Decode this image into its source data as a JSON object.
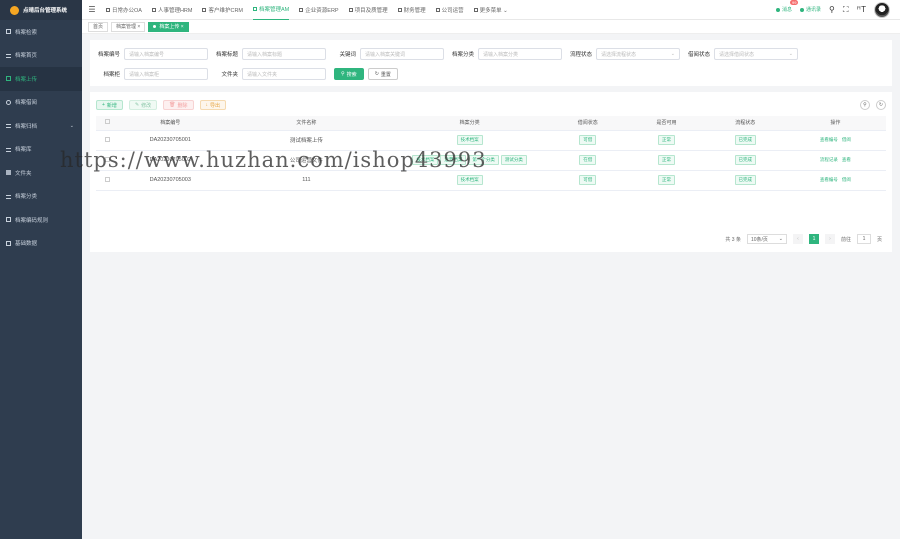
{
  "app": {
    "title": "点晴后台管理系统"
  },
  "sidebar": {
    "items": [
      {
        "label": "档案检索",
        "icon": "square-icon"
      },
      {
        "label": "档案首页",
        "icon": "bars-icon"
      },
      {
        "label": "档案上传",
        "icon": "square-icon",
        "active": true
      },
      {
        "label": "档案借阅",
        "icon": "gear-icon"
      },
      {
        "label": "档案归档",
        "icon": "bars-icon",
        "caret": "⌄"
      },
      {
        "label": "档案库",
        "icon": "bars-icon"
      },
      {
        "label": "文件夹",
        "icon": "chat-icon"
      },
      {
        "label": "档案分类",
        "icon": "bars-icon"
      },
      {
        "label": "档案编码规则",
        "icon": "square-icon"
      },
      {
        "label": "基础数据",
        "icon": "square-icon"
      }
    ]
  },
  "header": {
    "nav": [
      {
        "label": "日常办公OA"
      },
      {
        "label": "人事管理HRM"
      },
      {
        "label": "客户维护CRM"
      },
      {
        "label": "档案管理AM",
        "active": true
      },
      {
        "label": "企业资源ERP"
      },
      {
        "label": "项目及质管理"
      },
      {
        "label": "财务管理"
      },
      {
        "label": "公司运营"
      },
      {
        "label": "更多菜单 ⌄"
      }
    ],
    "notice_label": "消息",
    "notice_badge": "99",
    "contacts_label": "通讯录"
  },
  "tabs": [
    {
      "label": "首页"
    },
    {
      "label": "档案管理 ×"
    },
    {
      "label": "档案上传 ×",
      "active": true
    }
  ],
  "filters": {
    "row1": [
      {
        "label": "档案编号",
        "placeholder": "请输入档案编号"
      },
      {
        "label": "档案标题",
        "placeholder": "请输入档案标题"
      },
      {
        "label": "关键词",
        "placeholder": "请输入档案关键词"
      },
      {
        "label": "档案分类",
        "placeholder": "请输入档案分类"
      },
      {
        "label": "流程状态",
        "placeholder": "请选择流程状态",
        "select": true
      },
      {
        "label": "借阅状态",
        "placeholder": "请选择借阅状态",
        "select": true
      }
    ],
    "row2": [
      {
        "label": "档案柜",
        "placeholder": "请输入档案柜"
      },
      {
        "label": "文件夹",
        "placeholder": "请输入文件夹"
      }
    ],
    "search_label": "搜索",
    "reset_label": "重置"
  },
  "toolbar": {
    "add_label": "新增",
    "edit_label": "修改",
    "delete_label": "删除",
    "export_label": "导出"
  },
  "table": {
    "columns": [
      "档案编号",
      "文件名称",
      "档案分类",
      "借阅状态",
      "是否可用",
      "流程状态",
      "操作"
    ],
    "rows": [
      {
        "code": "DA20230705001",
        "name": "测试档案上传",
        "tags": [
          "技术档案"
        ],
        "borrow": "可借",
        "usable": "正常",
        "flow": "已完成",
        "ops": [
          "查看编号",
          "借阅"
        ]
      },
      {
        "code": "DA20230705002",
        "name": "公司运营文件",
        "tags": [
          "技术档案",
          "运营档案",
          "第一个分类",
          "测试分类"
        ],
        "borrow": "在借",
        "usable": "正常",
        "flow": "已完成",
        "ops": [
          "流程记录",
          "查看"
        ]
      },
      {
        "code": "DA20230705003",
        "name": "111",
        "tags": [
          "技术档案"
        ],
        "borrow": "可借",
        "usable": "正常",
        "flow": "已完成",
        "ops": [
          "查看编号",
          "借阅"
        ]
      }
    ]
  },
  "pager": {
    "total": "共 3 条",
    "page_size": "10条/页",
    "current": "1",
    "goto_label": "前往",
    "goto_value": "1",
    "page_unit": "页"
  },
  "watermark": "https://www.huzhan.com/ishop43993",
  "colors": {
    "accent": "#2fb57e",
    "sidebar": "#2f3d4f"
  }
}
